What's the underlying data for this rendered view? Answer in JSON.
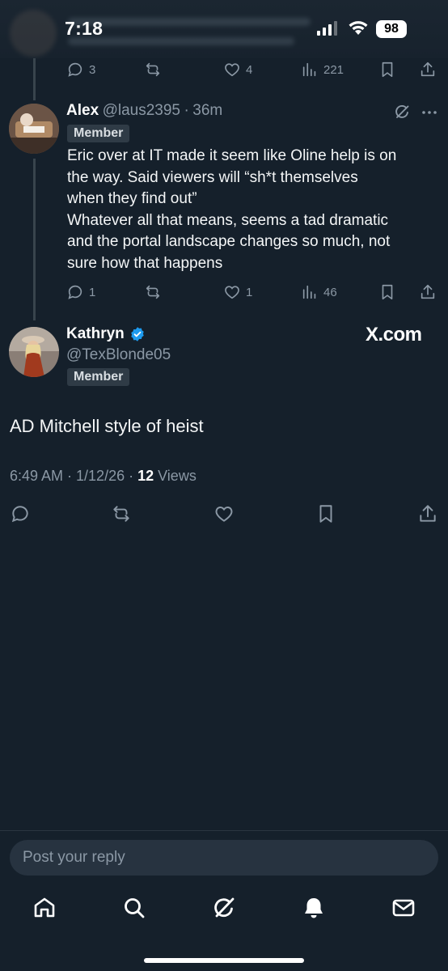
{
  "status_bar": {
    "time": "7:18",
    "battery": "98"
  },
  "top_tweet_actions": {
    "replies": "3",
    "reposts": "",
    "likes": "4",
    "views": "221"
  },
  "reply_tweet": {
    "name": "Alex",
    "handle": "@laus2395",
    "separator": "·",
    "time_ago": "36m",
    "badge": "Member",
    "lines": [
      "Eric over at IT made it seem like Oline help is on",
      "the way. Said viewers will “sh*t themselves",
      "when they find out”",
      "Whatever all that means, seems a tad dramatic",
      "and the portal landscape changes so much, not",
      "sure how that happens"
    ],
    "replies": "1",
    "likes": "1",
    "views": "46"
  },
  "main_tweet": {
    "name": "Kathryn",
    "handle": "@TexBlonde05",
    "badge": "Member",
    "watermark": "X.com",
    "text": "AD Mitchell style of heist",
    "timestamp": "6:49 AM · 1/12/26 · ",
    "views_count": "12",
    "views_label": " Views"
  },
  "reply_box": {
    "placeholder": "Post your reply"
  },
  "colors": {
    "background": "#15202b",
    "muted": "#8b98a5",
    "verified": "#1d9bf0",
    "badge_bg": "#2f3b46"
  },
  "icons": [
    "reply-icon",
    "repost-icon",
    "like-icon",
    "views-icon",
    "bookmark-icon",
    "share-icon",
    "grok-icon",
    "more-icon",
    "verified-icon",
    "home-icon",
    "search-icon",
    "notifications-icon",
    "messages-icon"
  ]
}
